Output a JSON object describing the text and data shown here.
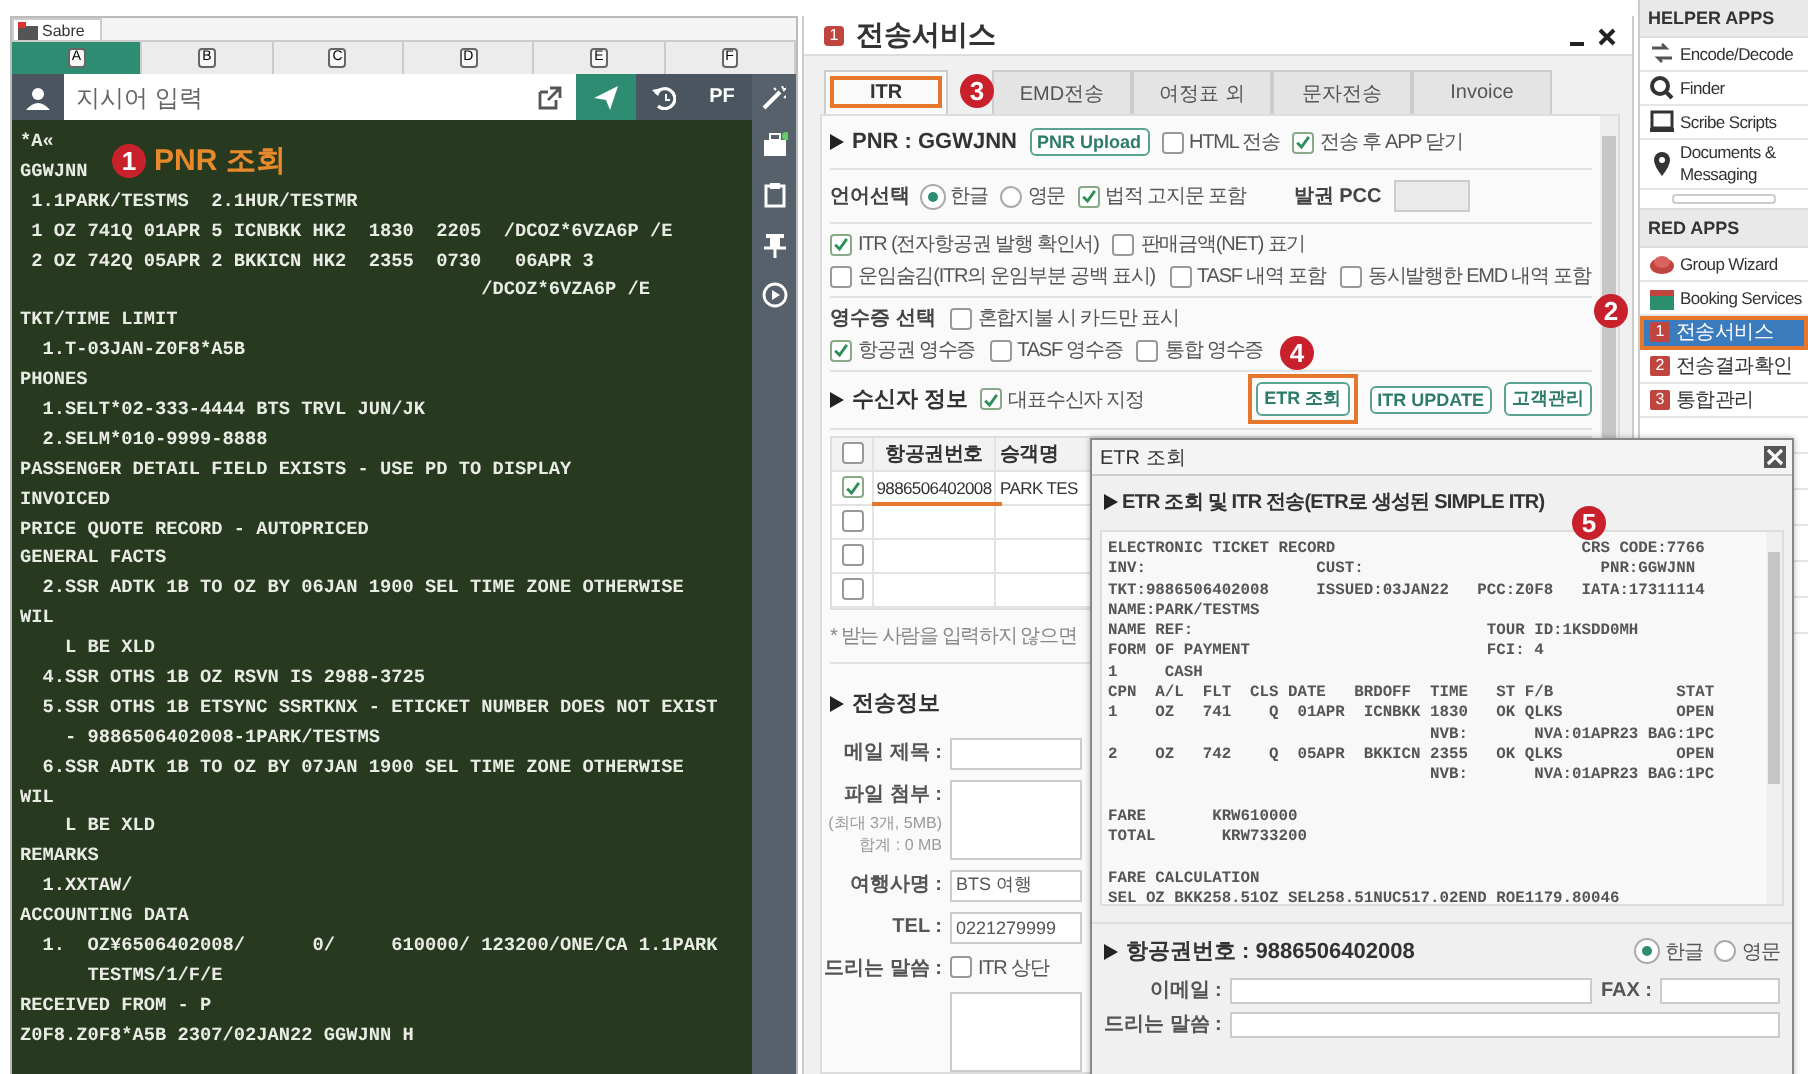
{
  "app_tab": {
    "label": "Sabre"
  },
  "terminal": {
    "sessions": [
      {
        "label": "A",
        "selected": true
      },
      {
        "label": "B",
        "selected": false
      },
      {
        "label": "C",
        "selected": false
      },
      {
        "label": "D",
        "selected": false
      },
      {
        "label": "E",
        "selected": false
      },
      {
        "label": "F",
        "selected": false
      }
    ],
    "command": {
      "placeholder": "지시어 입력"
    },
    "pf_button": "PF",
    "lines": [
      "*A«",
      "GGWJNN",
      " 1.1PARK/TESTMS  2.1HUR/TESTMR",
      " 1 OZ 741Q 01APR 5 ICNBKK HK2  1830  2205  /DCOZ*6VZA6P /E",
      " 2 OZ 742Q 05APR 2 BKKICN HK2  2355  0730   06APR 3",
      "                                         /DCOZ*6VZA6P /E",
      "TKT/TIME LIMIT",
      "  1.T-03JAN-Z0F8*A5B",
      "PHONES",
      "  1.SELT*02-333-4444 BTS TRVL JUN/JK",
      "  2.SELM*010-9999-8888",
      "PASSENGER DETAIL FIELD EXISTS - USE PD TO DISPLAY",
      "INVOICED",
      "PRICE QUOTE RECORD - AUTOPRICED",
      "GENERAL FACTS",
      "  2.SSR ADTK 1B TO OZ BY 06JAN 1900 SEL TIME ZONE OTHERWISE",
      "WIL",
      "    L BE XLD",
      "  4.SSR OTHS 1B OZ RSVN IS 2988-3725",
      "  5.SSR OTHS 1B ETSYNC SSRTKNX - ETICKET NUMBER DOES NOT EXIST",
      "    - 9886506402008-1PARK/TESTMS",
      "  6.SSR ADTK 1B TO OZ BY 07JAN 1900 SEL TIME ZONE OTHERWISE",
      "WIL",
      "    L BE XLD",
      "REMARKS",
      "  1.XXTAW/",
      "ACCOUNTING DATA",
      "  1.  OZ¥6506402008/      0/     610000/ 123200/ONE/CA 1.1PARK",
      "      TESTMS/1/F/E",
      "RECEIVED FROM - P",
      "Z0F8.Z0F8*A5B 2307/02JAN22 GGWJNN H"
    ]
  },
  "callouts": [
    {
      "number": "1",
      "caption": "PNR 조회"
    },
    {
      "number": "2"
    },
    {
      "number": "3"
    },
    {
      "number": "4"
    },
    {
      "number": "5"
    }
  ],
  "transmit_window": {
    "badge": "1",
    "title": "전송서비스",
    "tabs": [
      {
        "label": "ITR",
        "selected": true,
        "highlighted": true
      },
      {
        "label": "EMD전송",
        "selected": false,
        "highlighted": false
      },
      {
        "label": "여정표 외",
        "selected": false,
        "highlighted": false
      },
      {
        "label": "문자전송",
        "selected": false,
        "highlighted": false
      },
      {
        "label": "Invoice",
        "selected": false,
        "highlighted": false
      }
    ],
    "pnr": {
      "heading": "PNR : GGWJNN",
      "upload_button": "PNR Upload",
      "options": [
        {
          "label": "HTML 전송",
          "checked": false
        },
        {
          "label": "전송 후 APP 닫기",
          "checked": true
        }
      ]
    },
    "language": {
      "label": "언어선택",
      "choices": [
        {
          "label": "한글",
          "selected": true
        },
        {
          "label": "영문",
          "selected": false
        }
      ],
      "legal_notice": {
        "label": "법적 고지문 포함",
        "checked": true
      },
      "pcc_label": "발권 PCC"
    },
    "itr_options": [
      {
        "label": "ITR (전자항공권 발행 확인서)",
        "checked": true
      },
      {
        "label": "판매금액(NET) 표기",
        "checked": false
      },
      {
        "label": "운임숨김(ITR의 운임부분 공백 표시)",
        "checked": false
      },
      {
        "label": "TASF 내역 포함",
        "checked": false
      },
      {
        "label": "동시발행한 EMD 내역 포함",
        "checked": false
      }
    ],
    "receipt": {
      "label": "영수증 선택",
      "card_only": {
        "label": "혼합지불 시 카드만 표시",
        "checked": false
      },
      "types": [
        {
          "label": "항공권 영수증",
          "checked": true
        },
        {
          "label": "TASF 영수증",
          "checked": false
        },
        {
          "label": "통합 영수증",
          "checked": false
        }
      ]
    },
    "recipient": {
      "heading": "수신자 정보",
      "primary": {
        "label": "대표수신자 지정",
        "checked": true
      },
      "buttons": [
        {
          "label": "ETR 조회",
          "highlighted": true
        },
        {
          "label": "ITR UPDATE",
          "highlighted": false
        },
        {
          "label": "고객관리",
          "highlighted": false
        }
      ],
      "table": {
        "select_all": {
          "checked": false
        },
        "columns": [
          "항공권번호",
          "승객명"
        ],
        "rows": [
          {
            "checked": true,
            "underlined": true,
            "cells": [
              "9886506402008",
              "PARK TES"
            ]
          },
          {
            "checked": false,
            "underlined": false
          },
          {
            "checked": false,
            "underlined": false
          },
          {
            "checked": false,
            "underlined": false
          }
        ]
      },
      "note": "* 받는 사람을 입력하지 않으면"
    },
    "transmission": {
      "heading": "전송정보",
      "fields": [
        {
          "kind": "text",
          "label": "메일 제목 :"
        },
        {
          "kind": "file",
          "label": "파일 첨부 :",
          "hints": [
            "(최대 3개, 5MB)",
            "합계 : 0 MB"
          ]
        },
        {
          "kind": "text",
          "label": "여행사명 :",
          "value": "BTS 여행"
        },
        {
          "kind": "text",
          "label": "TEL :",
          "value": "0221279999"
        },
        {
          "kind": "message",
          "label": "드리는 말씀 :",
          "option": {
            "label": "ITR 상단",
            "checked": false
          }
        }
      ]
    }
  },
  "etr_popup": {
    "title": "ETR 조회",
    "heading": "ETR 조회 및 ITR 전송(ETR로 생성된 SIMPLE ITR)",
    "record": [
      [
        "ELECTRONIC TICKET RECORD                          CRS CODE:7766",
        "INV:                  CUST:                         PNR:GGWJNN",
        "TKT:9886506402008     ISSUED:03JAN22   PCC:Z0F8   IATA:17311114",
        "NAME:PARK/TESTMS",
        "NAME REF:                               TOUR ID:1KSDD0MH",
        "FORM OF PAYMENT                         FCI: 4",
        "1     CASH",
        "CPN  A/L  FLT  CLS DATE   BRDOFF  TIME   ST F/B             STAT",
        "1    OZ   741    Q  01APR  ICNBKK 1830   OK QLKS            OPEN",
        "                                  NVB:       NVA:01APR23 BAG:1PC",
        "2    OZ   742    Q  05APR  BKKICN 2355   OK QLKS            OPEN",
        "                                  NVB:       NVA:01APR23 BAG:1PC"
      ],
      [
        "FARE       KRW610000",
        "TOTAL       KRW733200"
      ],
      [
        "FARE CALCULATION",
        "SEL OZ BKK258.51OZ SEL258.51NUC517.02END ROE1179.80046"
      ]
    ],
    "ticket_heading": "항공권번호 : 9886506402008",
    "languages": [
      {
        "label": "한글",
        "selected": true
      },
      {
        "label": "영문",
        "selected": false
      }
    ],
    "fields": [
      {
        "label": "이메일 :"
      },
      {
        "label": "FAX :"
      },
      {
        "label": "드리는 말씀 :"
      }
    ]
  },
  "sidebar": {
    "sections": [
      {
        "title": "HELPER APPS",
        "items": [
          {
            "kind": "app",
            "label": "Encode/Decode",
            "selected": false,
            "highlighted": false
          },
          {
            "kind": "app",
            "label": "Finder",
            "selected": false,
            "highlighted": false
          },
          {
            "kind": "app",
            "label": "Scribe Scripts",
            "selected": false,
            "highlighted": false
          },
          {
            "kind": "app",
            "label": "Documents & Messaging",
            "selected": false,
            "highlighted": false
          }
        ]
      },
      {
        "title": "RED APPS",
        "items": [
          {
            "kind": "app",
            "label": "Group Wizard",
            "selected": false,
            "highlighted": false
          },
          {
            "kind": "app",
            "label": "Booking Services",
            "selected": false,
            "highlighted": false
          },
          {
            "kind": "numbered",
            "badge": "1",
            "label": "전송서비스",
            "selected": true,
            "highlighted": true
          },
          {
            "kind": "numbered",
            "badge": "2",
            "label": "전송결과확인",
            "selected": false,
            "highlighted": false
          },
          {
            "kind": "numbered",
            "badge": "3",
            "label": "통합관리",
            "selected": false,
            "highlighted": false
          }
        ]
      }
    ]
  }
}
